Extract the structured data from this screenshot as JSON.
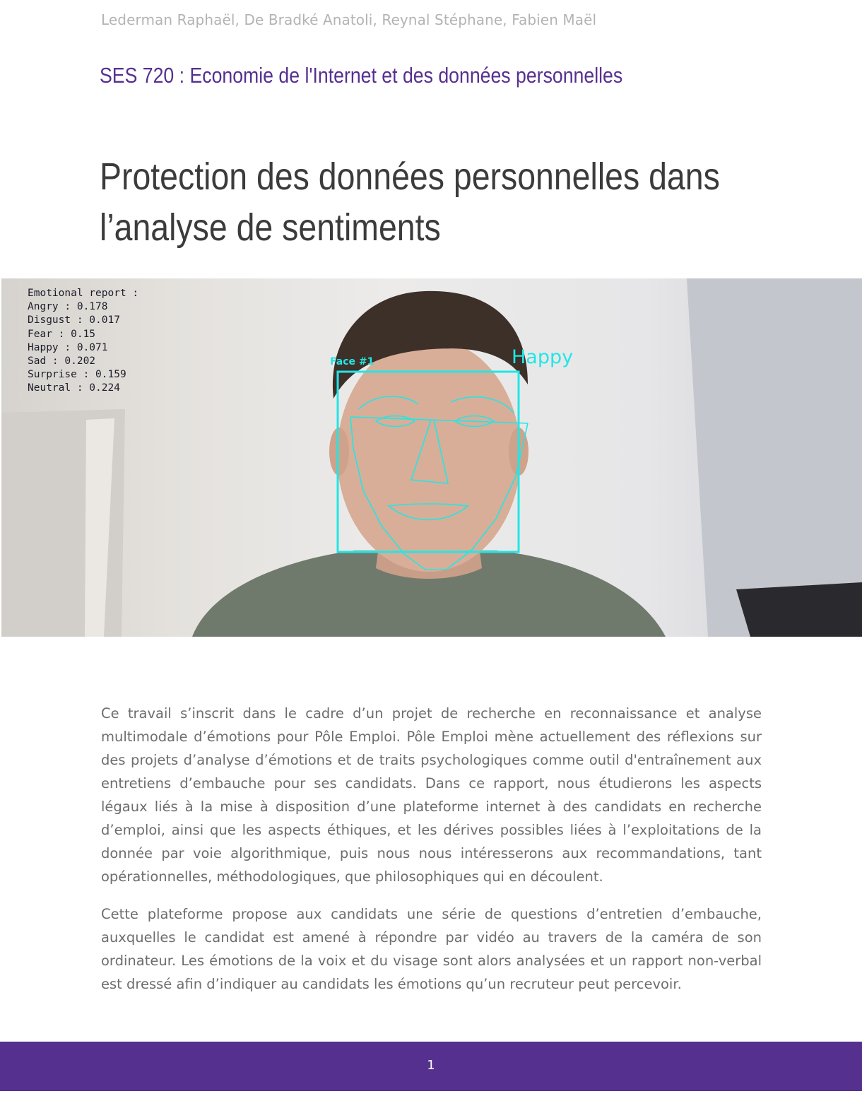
{
  "header": {
    "authors": "Lederman Raphaël, De Bradké Anatoli, Reynal Stéphane, Fabien Maël",
    "course": "SES 720 : Economie de l'Internet et des données personnelles"
  },
  "title": {
    "line1": "Protection des données personnelles dans",
    "line2": "l’analyse de sentiments"
  },
  "figure": {
    "report_lines": [
      "Emotional report :",
      "Angry : 0.178",
      "Disgust : 0.017",
      "Fear : 0.15",
      "Happy : 0.071",
      "Sad : 0.202",
      "Surprise : 0.159",
      "Neutral : 0.224"
    ],
    "face_label": "Face #1",
    "emotion_label": "Happy",
    "overlay_color": "#22e6e6"
  },
  "body": {
    "paragraphs": [
      "Ce travail s’inscrit dans le cadre d’un projet de recherche en reconnaissance et analyse multimodale d’émotions pour Pôle Emploi. Pôle Emploi mène actuellement des réflexions sur des projets d’analyse d’émotions et de traits psychologiques comme outil d'entraînement aux entretiens d’embauche pour ses candidats. Dans ce rapport, nous étudierons les aspects légaux liés à la mise à disposition d’une plateforme internet à des candidats en recherche d’emploi, ainsi que les aspects éthiques, et les dérives possibles liées à l’exploitations de la donnée par voie algorithmique, puis nous nous intéresserons aux recommandations, tant opérationnelles, méthodologiques, que philosophiques qui en découlent.",
      "Cette plateforme propose aux candidats une série de questions d’entretien d’embauche, auxquelles le candidat est amené à répondre par vidéo au travers de la caméra de son ordinateur. Les émotions de la voix et du visage sont alors analysées et un rapport non-verbal est dressé afin d’indiquer au candidats les émotions qu’un recruteur peut percevoir."
    ]
  },
  "footer": {
    "page_number": "1",
    "color": "#56308f"
  }
}
